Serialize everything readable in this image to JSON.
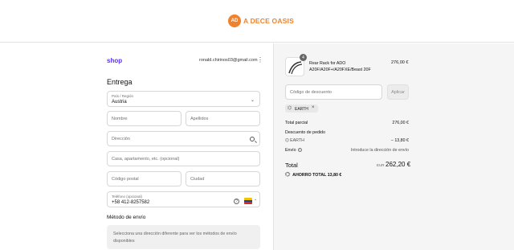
{
  "header": {
    "logo_mark": "AD",
    "logo_text": "A DECE OASIS"
  },
  "account": {
    "shop_label": "shop",
    "email": "ronald.chirinos03@gmail.com",
    "more": "⋮"
  },
  "delivery": {
    "heading": "Entrega",
    "country_label": "País / Región",
    "country_value": "Austria",
    "first_name_ph": "Nombre",
    "last_name_ph": "Apellidos",
    "address_ph": "Dirección",
    "apartment_ph": "Casa, apartamento, etc. (opcional)",
    "postal_ph": "Código postal",
    "city_ph": "Ciudad",
    "phone_label": "Teléfono (opcional)",
    "phone_value": "+58 412-8257582",
    "help": "?"
  },
  "shipping": {
    "heading": "Método de envío",
    "notice": "Selecciona una dirección diferente para ver los métodos de envío disponibles"
  },
  "summary": {
    "item": {
      "qty": "4",
      "name": "Rear Rack for ADO A20F/A20F+/A20FXE/Beast 20F",
      "price": "276,00 €"
    },
    "discount_placeholder": "Código de descuento",
    "apply_label": "Aplicar",
    "code_chip": "EARTH",
    "subtotal_label": "Total parcial",
    "subtotal_value": "276,00 €",
    "order_discount_label": "Descuento de pedido",
    "discount_code": "EARTH",
    "discount_value": "− 13,80 €",
    "shipping_label": "Envío",
    "shipping_value": "Introduce la dirección de envío",
    "total_label": "Total",
    "currency": "EUR",
    "total_value": "262,20 €",
    "saving_label": "AHORRO TOTAL",
    "saving_value": "13,80 €"
  },
  "colors": {
    "brand": "#f0822c",
    "shop": "#5a31f4",
    "summary_bg": "#f5f5f5"
  }
}
